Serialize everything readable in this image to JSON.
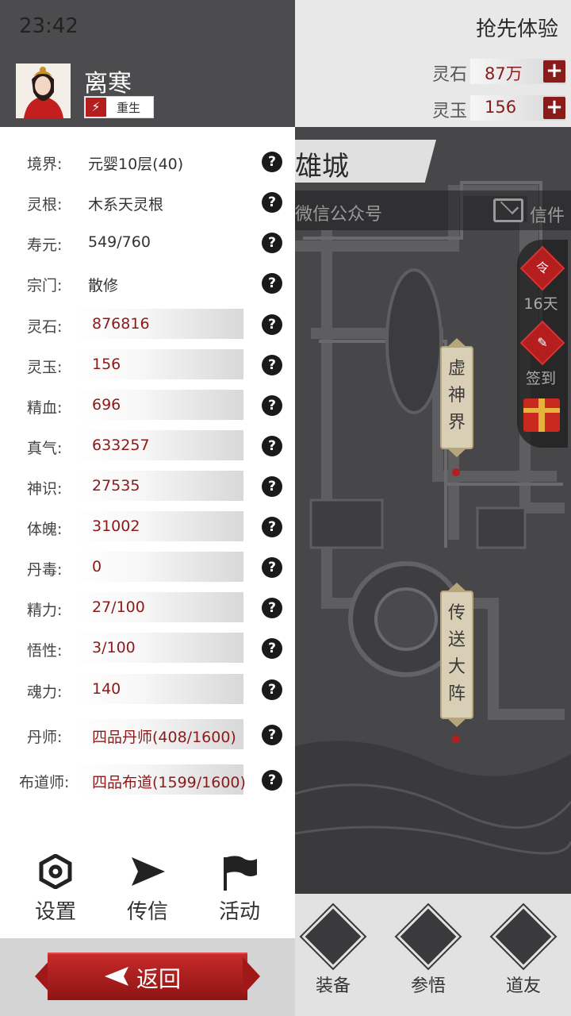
{
  "status_bar": {
    "time": "23:42"
  },
  "game": {
    "early_access": "抢先体验",
    "resources": [
      {
        "label": "灵石",
        "value": "87万"
      },
      {
        "label": "灵玉",
        "value": "156"
      }
    ],
    "city_name": "雄城",
    "wechat_text": "微信公众号",
    "mail_label": "信件",
    "side_items": [
      {
        "icon_text": "令",
        "label": "16天",
        "icon": "command-token-icon"
      },
      {
        "icon_text": "",
        "label": "签到",
        "icon": "checkin-icon"
      },
      {
        "icon_text": "",
        "label": "",
        "icon": "gift-icon"
      }
    ],
    "places": [
      "虚神界",
      "传送大阵"
    ],
    "nav": [
      {
        "label": "装备",
        "icon": "equipment-icon"
      },
      {
        "label": "参悟",
        "icon": "comprehend-icon"
      },
      {
        "label": "道友",
        "icon": "friends-icon"
      }
    ],
    "colors": {
      "accent": "#8b1a1a",
      "button_red": "#b41e1e"
    }
  },
  "drawer": {
    "name": "离寒",
    "rebirth_label": "重生",
    "stats_plain": [
      {
        "key": "境界:",
        "value": "元婴10层(40)"
      },
      {
        "key": "灵根:",
        "value": "木系天灵根"
      },
      {
        "key": "寿元:",
        "value": "549/760"
      },
      {
        "key": "宗门:",
        "value": "散修"
      }
    ],
    "stats_bar": [
      {
        "key": "灵石:",
        "value": "876816"
      },
      {
        "key": "灵玉:",
        "value": "156"
      },
      {
        "key": "精血:",
        "value": "696"
      },
      {
        "key": "真气:",
        "value": "633257"
      },
      {
        "key": "神识:",
        "value": "27535"
      },
      {
        "key": "体魄:",
        "value": "31002"
      },
      {
        "key": "丹毒:",
        "value": "0"
      },
      {
        "key": "精力:",
        "value": "27/100"
      },
      {
        "key": "悟性:",
        "value": "3/100"
      },
      {
        "key": "魂力:",
        "value": "140"
      },
      {
        "key": "丹师:",
        "value": "四品丹师(408/1600)"
      },
      {
        "key": "布道师:",
        "value": "四品布道(1599/1600)"
      }
    ],
    "help_glyph": "?",
    "tools": [
      {
        "label": "设置",
        "icon": "settings-icon"
      },
      {
        "label": "传信",
        "icon": "send-icon"
      },
      {
        "label": "活动",
        "icon": "flag-icon"
      }
    ],
    "return_label": "返回"
  }
}
